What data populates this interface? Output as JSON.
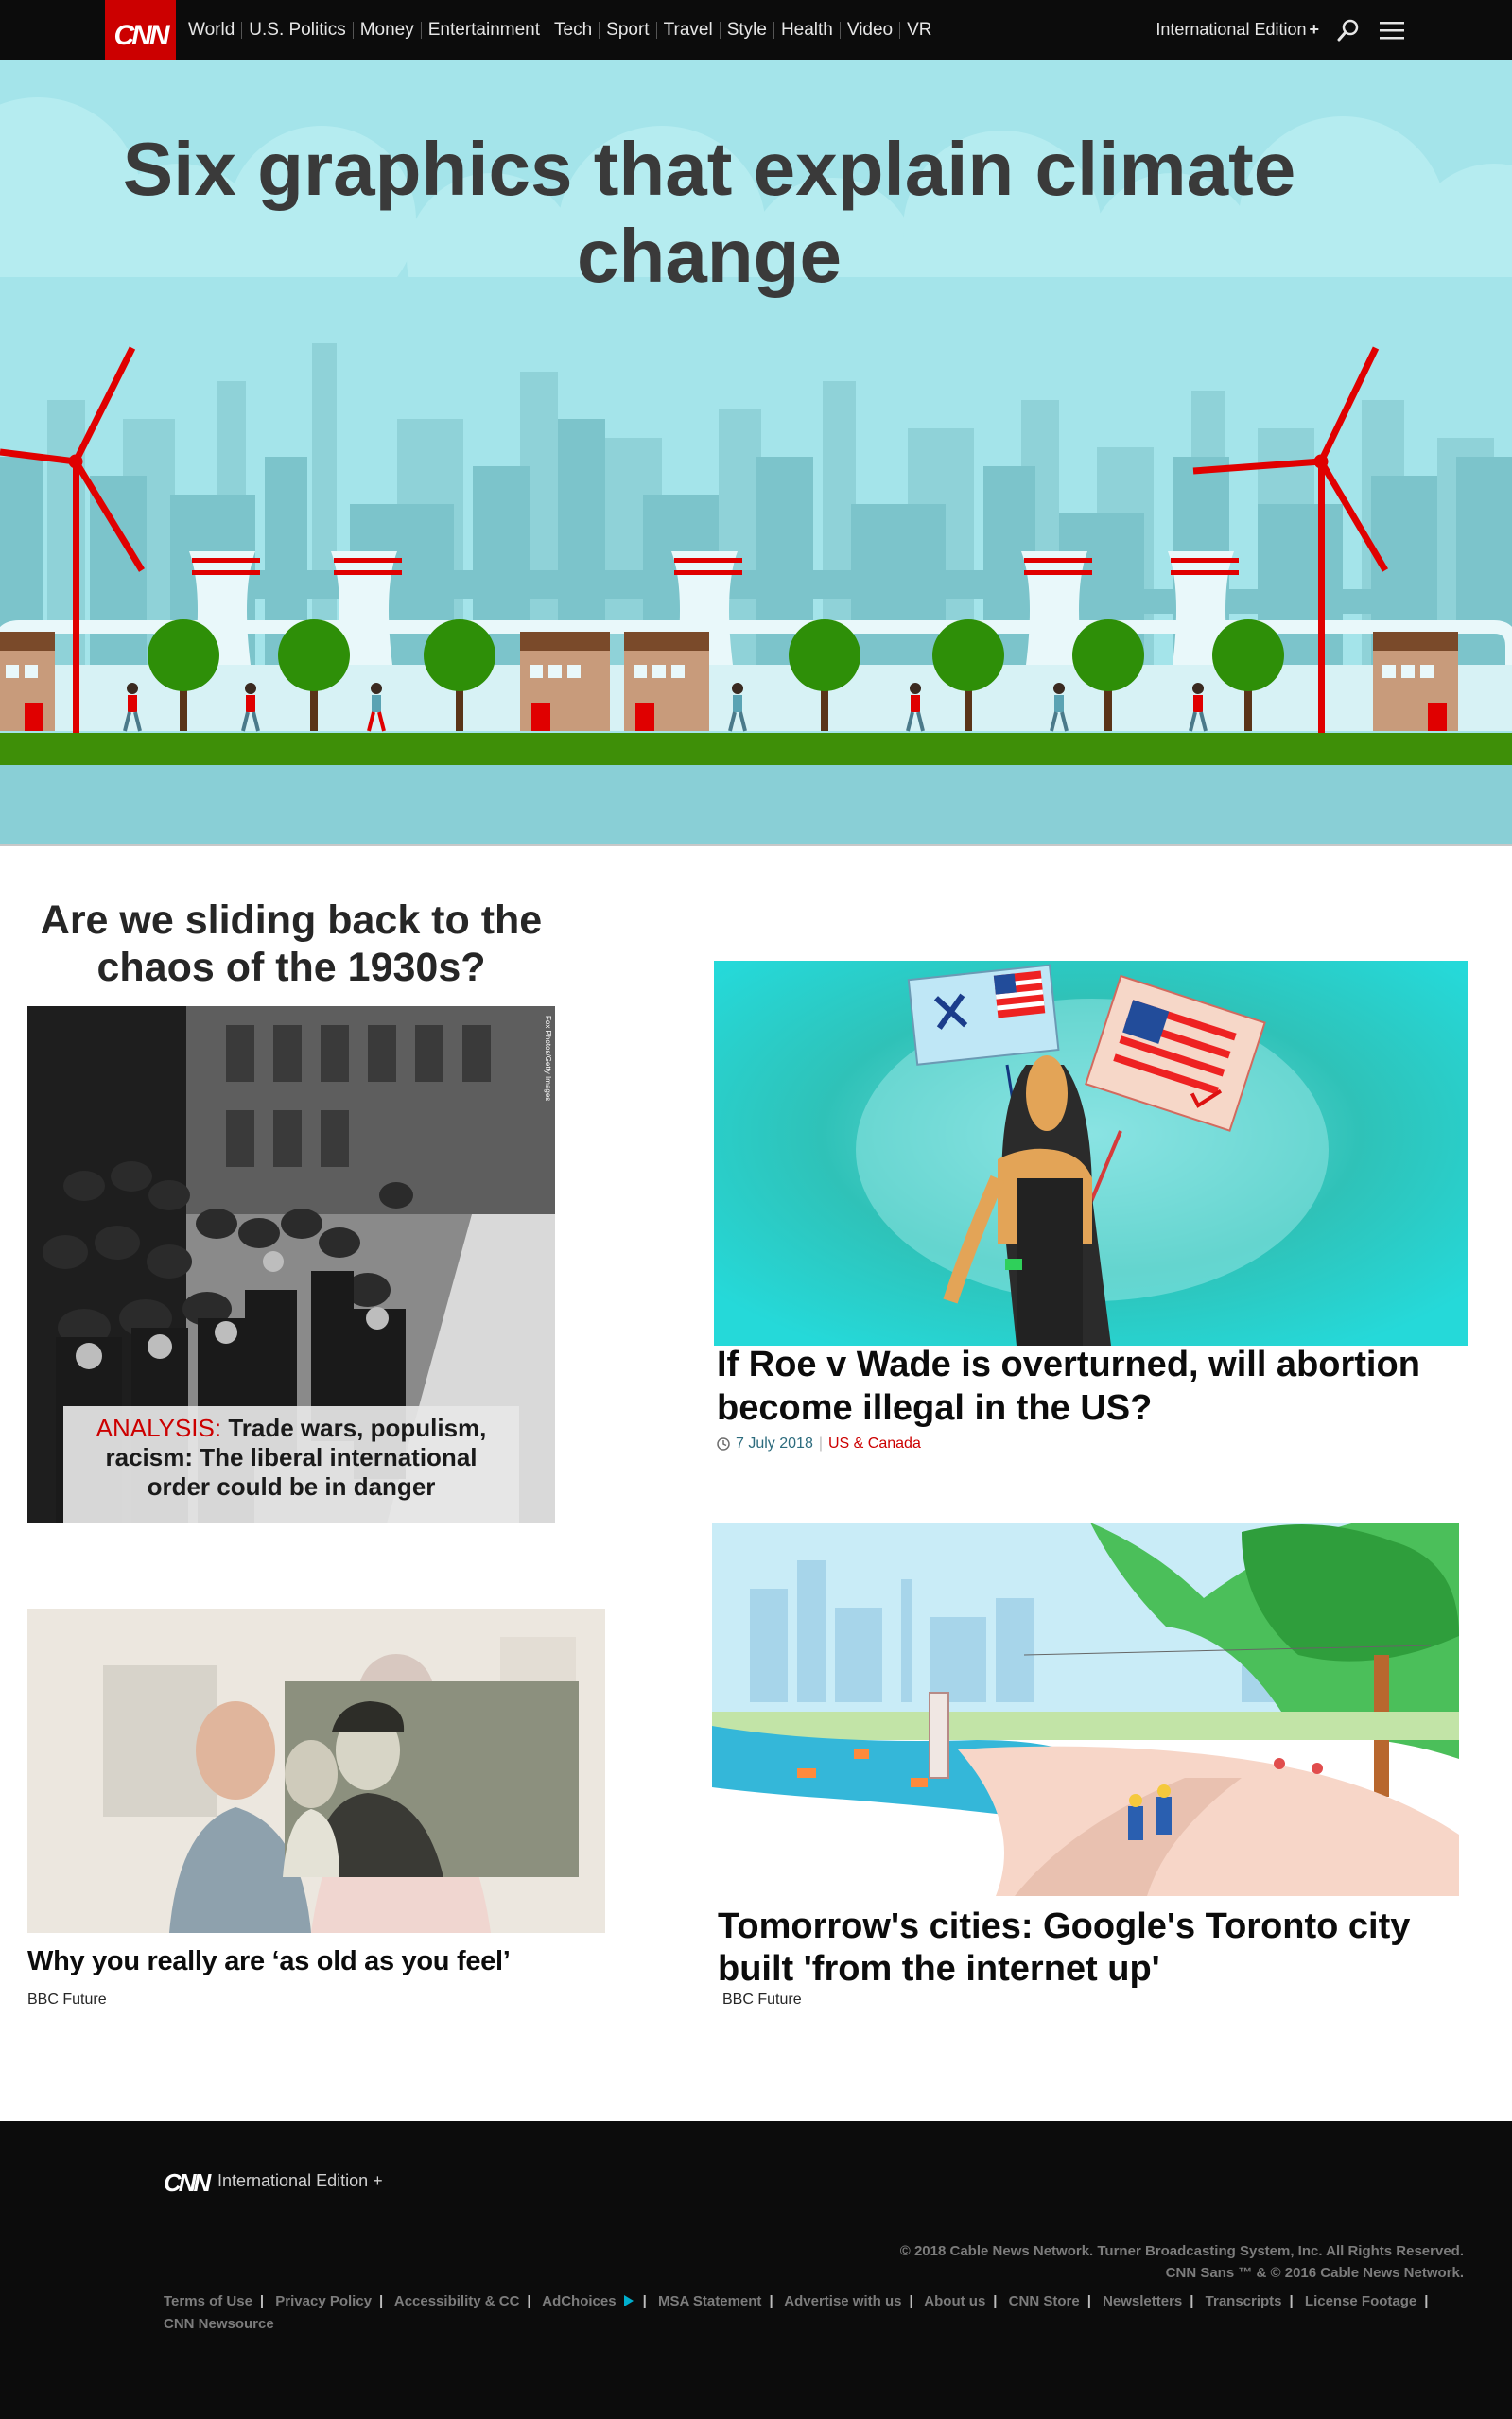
{
  "nav": {
    "logo": "CNN",
    "links": [
      "World",
      "U.S. Politics",
      "Money",
      "Entertainment",
      "Tech",
      "Sport",
      "Travel",
      "Style",
      "Health",
      "Video",
      "VR"
    ],
    "edition": "International Edition",
    "edition_plus": "+",
    "search_icon": "search-icon",
    "menu_icon": "hamburger-menu-icon"
  },
  "hero": {
    "title": "Six graphics that explain climate change"
  },
  "stories": {
    "analysis": {
      "headline": "Are we sliding back to the chaos of the 1930s?",
      "image_credit": "Fox Photos/Getty Images",
      "kicker": "ANALYSIS:",
      "summary": "Trade wars, populism, racism: The liberal international order could be in danger"
    },
    "roe": {
      "title": "If Roe v Wade is overturned, will abortion become illegal in the US?",
      "date": "7 July 2018",
      "section": "US & Canada"
    },
    "old": {
      "title": "Why you really are ‘as old as you feel’",
      "source": "BBC Future"
    },
    "city": {
      "title": "Tomorrow's cities: Google's Toronto city built 'from the internet up'",
      "source": "BBC Future"
    }
  },
  "footer": {
    "logo": "CNN",
    "edition": "International Edition",
    "edition_plus": "+",
    "copyright_line1": "© 2018 Cable News Network. Turner Broadcasting System, Inc. All Rights Reserved.",
    "copyright_line2": "CNN Sans ™ & © 2016 Cable News Network.",
    "links": [
      "Terms of Use",
      "Privacy Policy",
      "Accessibility & CC",
      "AdChoices",
      "MSA Statement",
      "Advertise with us",
      "About us",
      "CNN Store",
      "Newsletters",
      "Transcripts",
      "License Footage",
      "CNN Newsource"
    ]
  },
  "colors": {
    "brand_red": "#cc0000",
    "nav_bg": "#0c0c0c",
    "hero_sky": "#a4e4ea",
    "link_teal": "#2c6b7d"
  }
}
